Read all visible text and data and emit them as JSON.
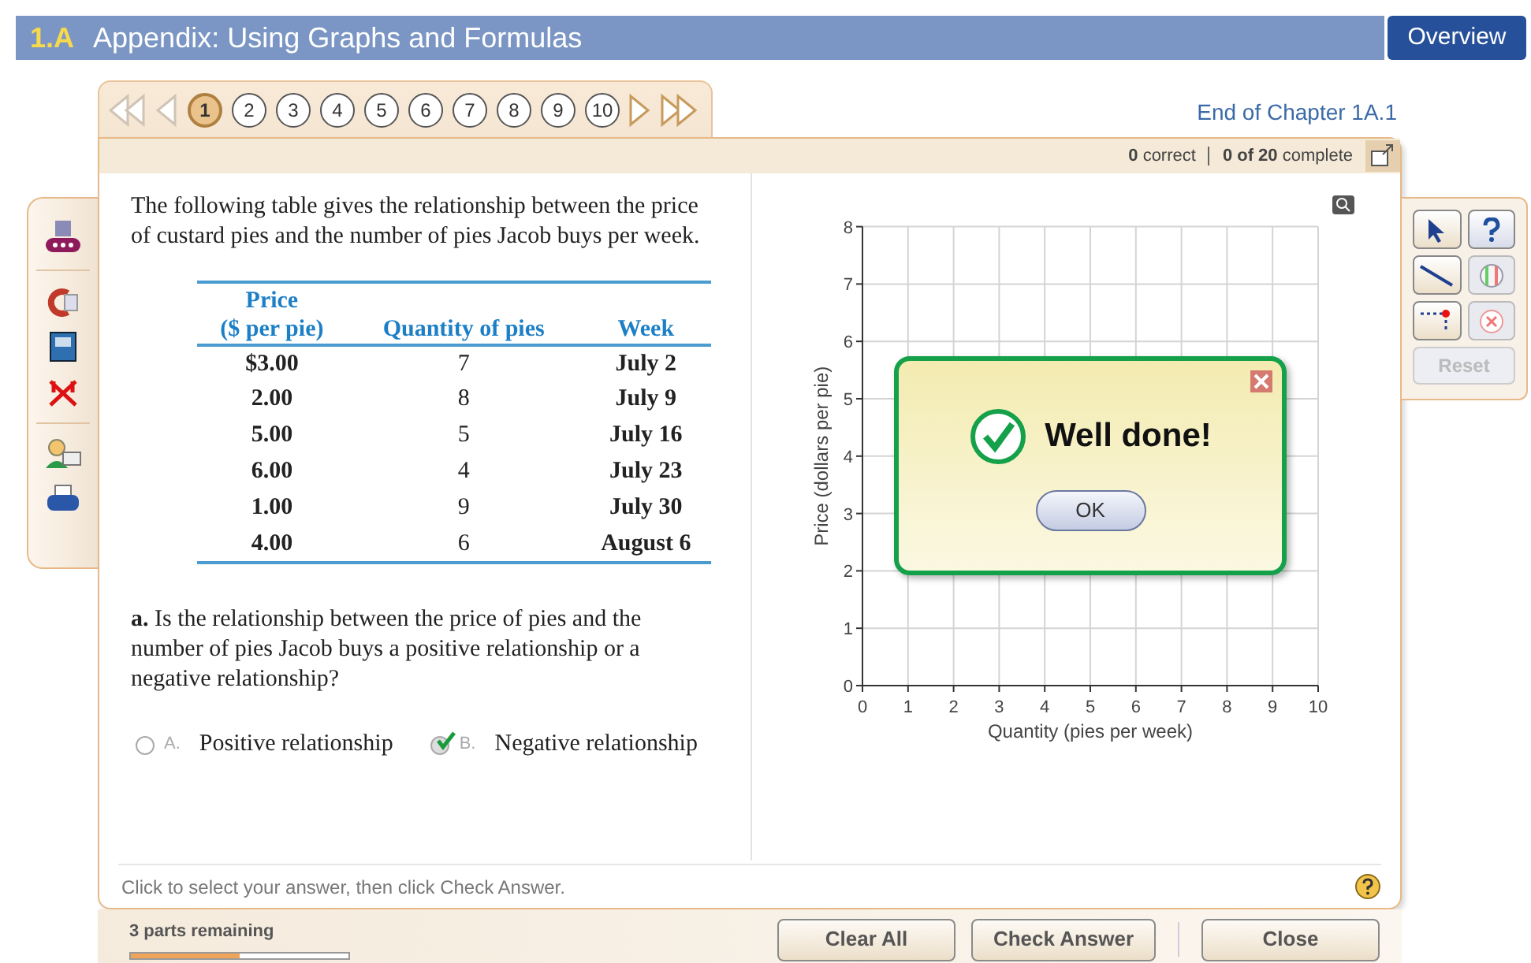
{
  "header": {
    "section": "1.A",
    "title": "Appendix: Using Graphs and Formulas",
    "overview_button": "Overview"
  },
  "question_nav": {
    "back_disabled": true,
    "forward_disabled": false,
    "pages": [
      {
        "label": "1",
        "selected": true
      },
      {
        "label": "2",
        "selected": false
      },
      {
        "label": "3",
        "selected": false
      },
      {
        "label": "4",
        "selected": false
      },
      {
        "label": "5",
        "selected": false
      },
      {
        "label": "6",
        "selected": false
      },
      {
        "label": "7",
        "selected": false
      },
      {
        "label": "8",
        "selected": false
      },
      {
        "label": "9",
        "selected": false
      },
      {
        "label": "10",
        "selected": false
      }
    ]
  },
  "end_of_chapter_link": "End of Chapter 1A.1",
  "status": {
    "correct_count": "0",
    "correct_label": "correct",
    "complete_count": "0 of 20",
    "complete_label": "complete"
  },
  "problem": {
    "intro": "The following table gives the relationship between the price of custard pies and the number of pies Jacob buys per week.",
    "table": {
      "columns": [
        "Price\n($ per pie)",
        "Quantity of pies",
        "Week"
      ],
      "rows": [
        [
          "$3.00",
          "7",
          "July 2"
        ],
        [
          "2.00",
          "8",
          "July 9"
        ],
        [
          "5.00",
          "5",
          "July 16"
        ],
        [
          "6.00",
          "4",
          "July 23"
        ],
        [
          "1.00",
          "9",
          "July 30"
        ],
        [
          "4.00",
          "6",
          "August 6"
        ]
      ]
    },
    "question": "**a.** Is the relationship between the price of pies and the number of pies Jacob buys a positive relationship or a negative relationship?",
    "options": [
      {
        "letter": "A.",
        "label": "Positive relationship",
        "selected": false
      },
      {
        "letter": "B.",
        "label": "Negative relationship",
        "selected": true
      }
    ]
  },
  "graph": {
    "chart_data": {
      "type": "scatter",
      "grid": true,
      "xlabel": "Quantity (pies per week)",
      "ylabel": "Price (dollars per pie)",
      "xlim": [
        0,
        10
      ],
      "ylim": [
        0,
        8
      ],
      "xticks": [
        0,
        1,
        2,
        3,
        4,
        5,
        6,
        7,
        8,
        9,
        10
      ],
      "yticks": [
        0,
        1,
        2,
        3,
        4,
        5,
        6,
        7,
        8
      ]
    }
  },
  "dialog": {
    "message": "Well done!",
    "ok_button": "OK"
  },
  "graph_tools": {
    "reset_button": "Reset",
    "reset_disabled": true
  },
  "instruction": "Click to select your answer, then click Check Answer.",
  "progress": {
    "label": "3 parts remaining",
    "level": 0.5
  },
  "buttons": [
    "Clear All",
    "Check Answer",
    "Close"
  ]
}
